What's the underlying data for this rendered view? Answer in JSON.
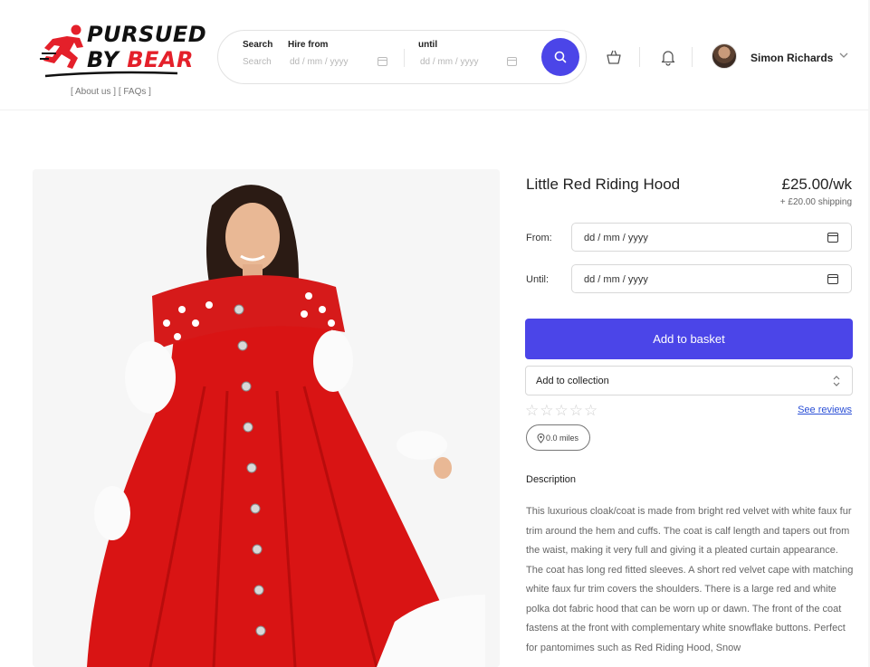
{
  "brand": {
    "logo_line1": "PURSUED",
    "logo_by": "BY",
    "logo_bear": "BEAR",
    "links": "[ About us ]  [ FAQs ]",
    "accent_color": "#4b45e8",
    "logo_red": "#e4202a"
  },
  "search": {
    "search_label": "Search",
    "search_placeholder": "Search",
    "hire_from_label": "Hire from",
    "hire_from_placeholder": "dd / mm / yyyy",
    "until_label": "until",
    "until_placeholder": "dd / mm / yyyy",
    "button_icon": "search-icon"
  },
  "header": {
    "basket_icon": "basket-icon",
    "bell_icon": "bell-icon",
    "user_name": "Simon Richards"
  },
  "product": {
    "title": "Little Red Riding Hood",
    "price": "£25.00/wk",
    "shipping": "+ £20.00 shipping",
    "from_label": "From:",
    "from_placeholder": "dd / mm / yyyy",
    "until_label": "Until:",
    "until_placeholder": "dd / mm / yyyy",
    "add_to_basket": "Add to basket",
    "collection_select": "Add to collection",
    "rating_stars": "☆☆☆☆☆",
    "rating": 0,
    "see_reviews": "See reviews",
    "distance": "0.0 miles",
    "description_heading": "Description",
    "description": "This luxurious cloak/coat is made from bright red velvet with white faux fur trim around the hem and cuffs. The coat is calf length and tapers out from the waist, making it very full and giving it a pleated curtain appearance. The coat has long red fitted sleeves. A short red velvet cape with matching white faux fur trim covers the shoulders. There is a large red and white polka dot fabric hood that can be worn up or dawn. The front of the coat fastens at the front with complementary white snowflake buttons. Perfect for pantomimes such as Red Riding Hood, Snow"
  }
}
